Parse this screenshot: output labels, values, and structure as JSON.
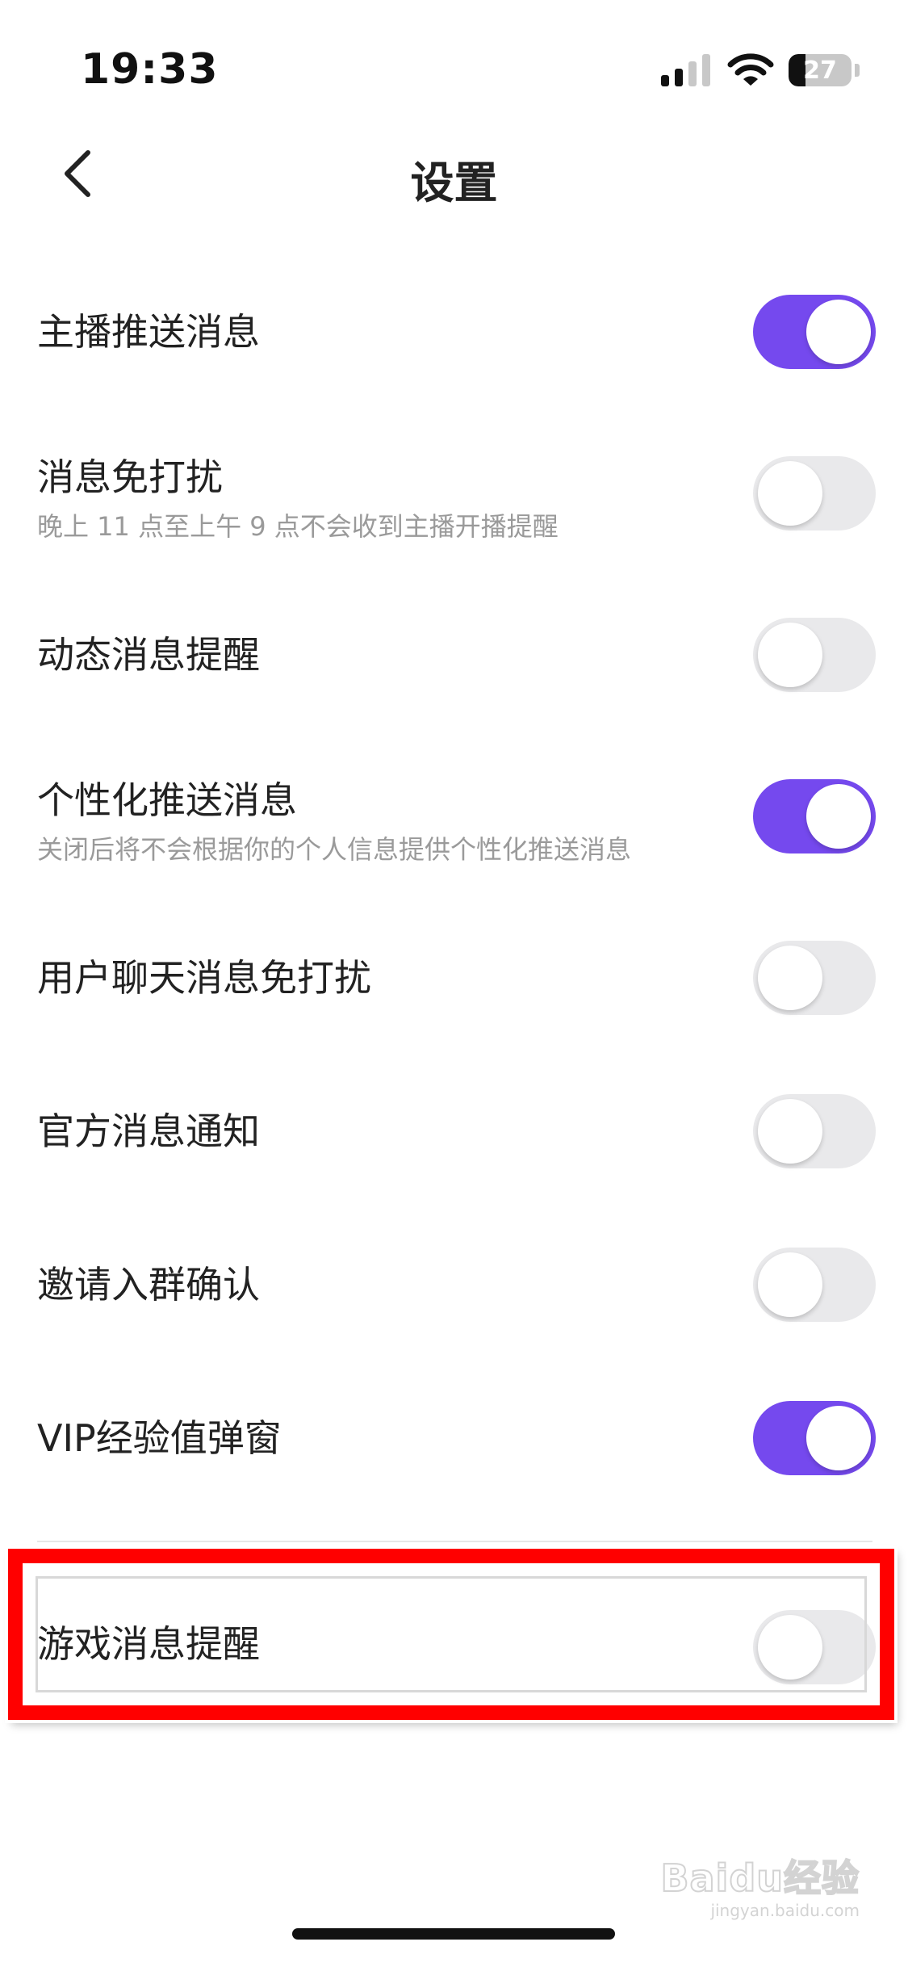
{
  "status_bar": {
    "time": "19:33",
    "battery_level": "27",
    "battery_fraction": 0.27
  },
  "header": {
    "back_icon": "chevron-left-icon",
    "title": "设置"
  },
  "settings": [
    {
      "title": "主播推送消息",
      "subtitle": "",
      "enabled": true
    },
    {
      "title": "消息免打扰",
      "subtitle": "晚上 11 点至上午 9 点不会收到主播开播提醒",
      "enabled": false
    },
    {
      "title": "动态消息提醒",
      "subtitle": "",
      "enabled": false
    },
    {
      "title": "个性化推送消息",
      "subtitle": "关闭后将不会根据你的个人信息提供个性化推送消息",
      "enabled": true
    },
    {
      "title": "用户聊天消息免打扰",
      "subtitle": "",
      "enabled": false
    },
    {
      "title": "官方消息通知",
      "subtitle": "",
      "enabled": false
    },
    {
      "title": "邀请入群确认",
      "subtitle": "",
      "enabled": false
    },
    {
      "title": "VIP经验值弹窗",
      "subtitle": "",
      "enabled": true
    },
    {
      "title": "游戏消息提醒",
      "subtitle": "",
      "enabled": false
    }
  ],
  "colors": {
    "toggle_on": "#7549ee",
    "toggle_off": "#e9e9eb",
    "highlight": "#ff0000"
  },
  "watermark": {
    "brand": "Baidu经验",
    "sub": "jingyan.baidu.com"
  }
}
